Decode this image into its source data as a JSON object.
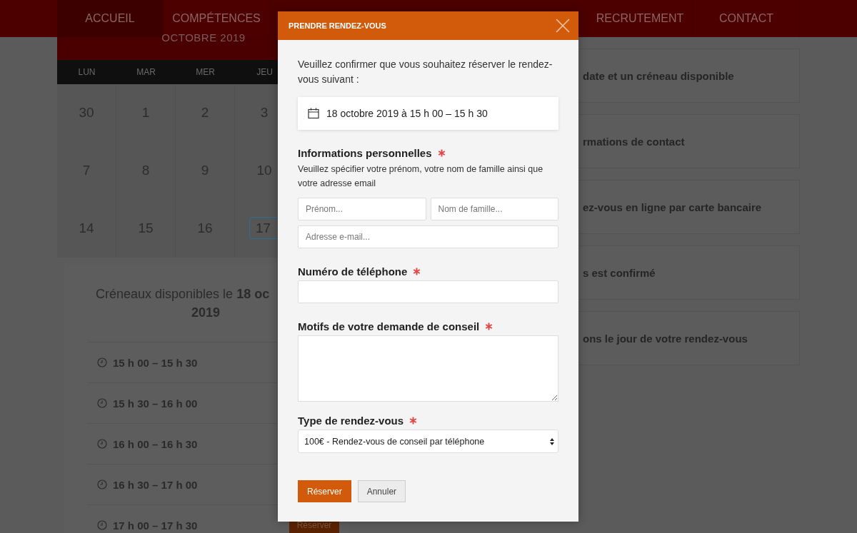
{
  "nav": {
    "items": [
      {
        "label": "ACCUEIL",
        "selected": true
      },
      {
        "label": "COMPÉTENCES",
        "selected": false
      },
      {
        "label": "RECRUTEMENT",
        "selected": false
      },
      {
        "label": "CONTACT",
        "selected": false
      }
    ]
  },
  "calendar": {
    "month": "OCTOBRE 2019",
    "weekdays": [
      "LUN",
      "MAR",
      "MER",
      "JEU"
    ],
    "weeks": [
      [
        {
          "day": "30",
          "selected": false
        },
        {
          "day": "1",
          "selected": false
        },
        {
          "day": "2",
          "selected": false
        },
        {
          "day": "3",
          "selected": false
        }
      ],
      [
        {
          "day": "7",
          "selected": false
        },
        {
          "day": "8",
          "selected": false
        },
        {
          "day": "9",
          "selected": false
        },
        {
          "day": "10",
          "selected": false
        }
      ],
      [
        {
          "day": "14",
          "selected": false
        },
        {
          "day": "15",
          "selected": false
        },
        {
          "day": "16",
          "selected": false
        },
        {
          "day": "17",
          "selected": true
        }
      ]
    ]
  },
  "slots": {
    "title": "Créneaux disponibles le **18 oc**",
    "title_line2": "2019",
    "items": [
      {
        "time": "15 h 00 – 15 h 30"
      },
      {
        "time": "15 h 30 – 16 h 00"
      },
      {
        "time": "16 h 00 – 16 h 30"
      },
      {
        "time": "16 h 30 – 17 h 00"
      },
      {
        "time": "17 h 00 – 17 h 30",
        "button": "Réserver"
      }
    ]
  },
  "steps": [
    {
      "text": "date et un créneau disponible"
    },
    {
      "text": "rmations de contact"
    },
    {
      "text": "ez-vous en ligne par carte bancaire"
    },
    {
      "text": "s est confirmé"
    },
    {
      "text": "ons le jour de votre rendez-vous"
    }
  ],
  "modal": {
    "title": "PRENDRE RENDEZ-VOUS",
    "intro": "Veuillez confirmer que vous souhaitez réserver le rendez-vous suivant :",
    "appointment": "18 octobre 2019 à 15 h 00 – 15 h 30",
    "sections": [
      {
        "kind": "personal",
        "label": "Informations personnelles",
        "required": true,
        "hint": "Veuillez spécifier votre prénom, votre nom de famille ainsi que votre adresse email",
        "inputs": [
          {
            "placeholder": "Prénom..."
          },
          {
            "placeholder": "Nom de famille..."
          },
          {
            "placeholder": "Adresse e-mail..."
          }
        ]
      },
      {
        "kind": "text",
        "label": "Numéro de téléphone",
        "required": true
      },
      {
        "kind": "textarea",
        "label": "Motifs de votre demande de conseil",
        "required": true
      },
      {
        "kind": "select",
        "label": "Type de rendez-vous",
        "required": true,
        "value": "100€ - Rendez-vous de conseil par téléphone"
      }
    ],
    "buttons": [
      {
        "label": "Réserver",
        "kind": "primary"
      },
      {
        "label": "Annuler",
        "kind": "secondary"
      }
    ]
  }
}
